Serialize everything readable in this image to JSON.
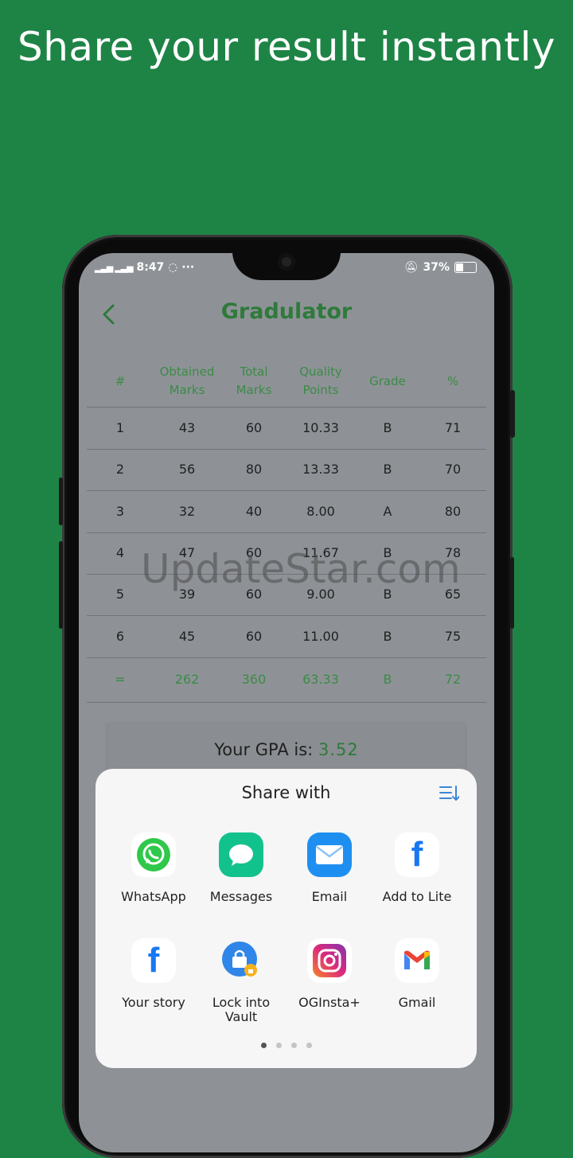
{
  "headline": "Share your result instantly",
  "status": {
    "time": "8:47",
    "battery": "37%"
  },
  "app": {
    "title": "Gradulator"
  },
  "table": {
    "headers": [
      [
        "#"
      ],
      [
        "Obtained",
        "Marks"
      ],
      [
        "Total",
        "Marks"
      ],
      [
        "Quality",
        "Points"
      ],
      [
        "Grade"
      ],
      [
        "%"
      ]
    ],
    "rows": [
      [
        "1",
        "43",
        "60",
        "10.33",
        "B",
        "71"
      ],
      [
        "2",
        "56",
        "80",
        "13.33",
        "B",
        "70"
      ],
      [
        "3",
        "32",
        "40",
        "8.00",
        "A",
        "80"
      ],
      [
        "4",
        "47",
        "60",
        "11.67",
        "B",
        "78"
      ],
      [
        "5",
        "39",
        "60",
        "9.00",
        "B",
        "65"
      ],
      [
        "6",
        "45",
        "60",
        "11.00",
        "B",
        "75"
      ]
    ],
    "total": [
      "=",
      "262",
      "360",
      "63.33",
      "B",
      "72"
    ]
  },
  "gpa": {
    "label": "Your GPA is:",
    "value": "3.52"
  },
  "watermark": "UpdateStar.com",
  "share": {
    "title": "Share with",
    "apps": [
      {
        "label": "WhatsApp",
        "icon": "whatsapp-icon"
      },
      {
        "label": "Messages",
        "icon": "messages-icon"
      },
      {
        "label": "Email",
        "icon": "email-icon"
      },
      {
        "label": "Add to Lite",
        "icon": "facebook-icon"
      },
      {
        "label": "Your story",
        "icon": "facebook-icon"
      },
      {
        "label": "Lock into Vault",
        "icon": "vault-lock-icon"
      },
      {
        "label": "OGInsta+",
        "icon": "oginsta-icon"
      },
      {
        "label": "Gmail",
        "icon": "gmail-icon"
      }
    ],
    "page_count": 4,
    "active_page": 1
  },
  "colors": {
    "background": "#1e8446",
    "accent": "#2e7a3a",
    "screen_dim": "#8e9297",
    "sheet": "#f6f6f6"
  }
}
